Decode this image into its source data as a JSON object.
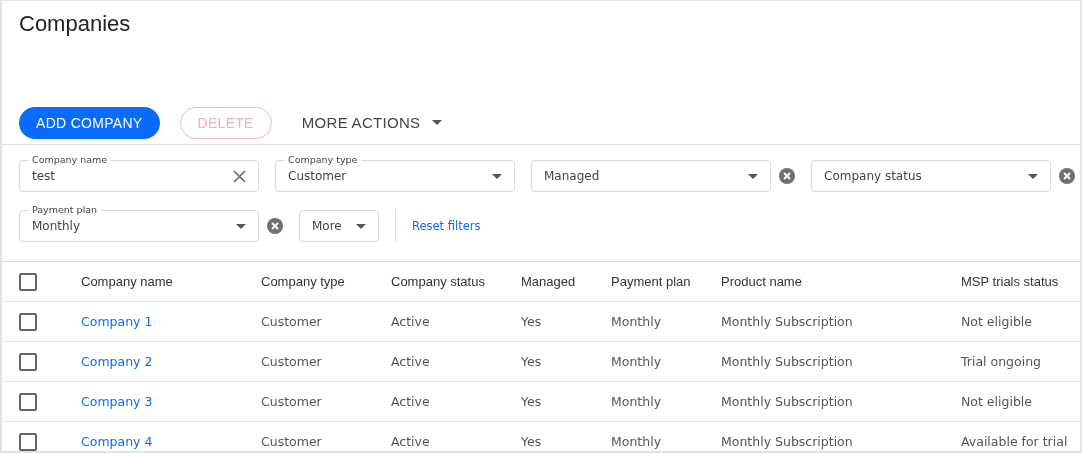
{
  "title": "Companies",
  "actions": [
    {
      "label": "ADD COMPANY",
      "kind": "primary",
      "disabled": false
    },
    {
      "label": "DELETE",
      "kind": "danger",
      "disabled": true
    },
    {
      "label": "MORE ACTIONS",
      "kind": "menu",
      "disabled": false
    }
  ],
  "filters": [
    [
      {
        "kind": "text",
        "label": "Company name",
        "value": "test",
        "clearable": true
      },
      {
        "kind": "select",
        "label": "Company type",
        "value": "Customer",
        "clearable": false
      },
      {
        "kind": "select",
        "value": "Managed",
        "clearable": true
      },
      {
        "kind": "select",
        "value": "Company status",
        "clearable": true
      }
    ],
    [
      {
        "kind": "select",
        "label": "Payment plan",
        "value": "Monthly",
        "clearable": true
      },
      {
        "kind": "more",
        "value": "More"
      },
      {
        "kind": "link",
        "value": "Reset filters"
      }
    ]
  ],
  "table": {
    "columns": [
      "Company name",
      "Company type",
      "Company status",
      "Managed",
      "Payment plan",
      "Product name",
      "MSP trials status"
    ],
    "header_checked": false,
    "rows": [
      {
        "checked": false,
        "cells": [
          "Company 1",
          "Customer",
          "Active",
          "Yes",
          "Monthly",
          "Monthly Subscription",
          "Not eligible"
        ]
      },
      {
        "checked": false,
        "cells": [
          "Company 2",
          "Customer",
          "Active",
          "Yes",
          "Monthly",
          "Monthly Subscription",
          "Trial ongoing"
        ]
      },
      {
        "checked": false,
        "cells": [
          "Company 3",
          "Customer",
          "Active",
          "Yes",
          "Monthly",
          "Monthly Subscription",
          "Not eligible"
        ]
      },
      {
        "checked": false,
        "cells": [
          "Company 4",
          "Customer",
          "Active",
          "Yes",
          "Monthly",
          "Monthly Subscription",
          "Available for trial"
        ]
      }
    ]
  }
}
